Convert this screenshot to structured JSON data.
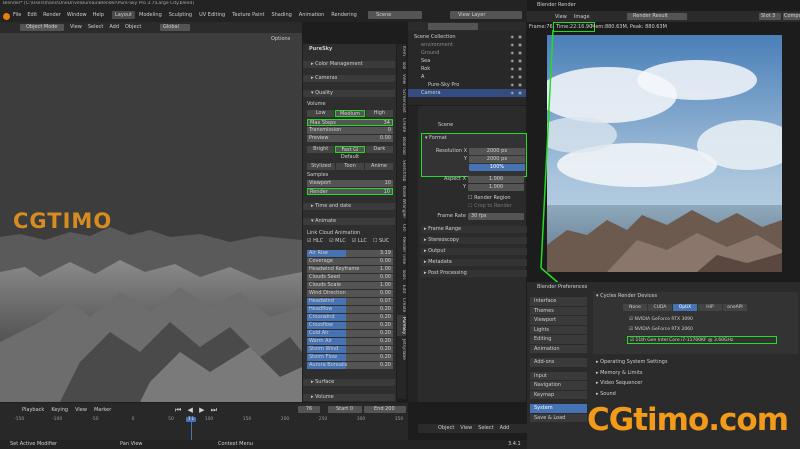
{
  "window": {
    "title": "Blender* [C:\\Users\\hans\\OneDrive\\Bureau\\Blender\\Pure-Sky Pro 3.7\\Large City.blend]"
  },
  "menu": [
    "File",
    "Edit",
    "Render",
    "Window",
    "Help"
  ],
  "workspaces": [
    "Layout",
    "Modeling",
    "Sculpting",
    "UV Editing",
    "Texture Paint",
    "Shading",
    "Animation",
    "Rendering"
  ],
  "viewport": {
    "mode": "Object Mode",
    "header_items": [
      "View",
      "Select",
      "Add",
      "Object"
    ],
    "orientation": "Global",
    "options": "Options"
  },
  "scene_field": "Scene",
  "view_layer": "View Layer",
  "npanel": {
    "title": "PureSky",
    "panels": {
      "color_mgmt": "Color Management",
      "cameras": "Cameras",
      "quality": "Quality"
    },
    "volume": "Volume",
    "quality_buttons": [
      "Low",
      "Medium",
      "High"
    ],
    "max_steps_label": "Max Steps",
    "max_steps": "34",
    "transmission_label": "Transmission",
    "transmission": "0",
    "preview_label": "Preview",
    "preview": "0.00",
    "gi_buttons": [
      "Bright",
      "Fast GI",
      "Dark"
    ],
    "default": "Default",
    "style_buttons": [
      "Stylized",
      "Toon",
      "Anime"
    ],
    "samples": "Samples",
    "viewport_label": "Viewport",
    "viewport_val": "10",
    "render_label": "Render",
    "render_val": "10",
    "time_date": "Time and date",
    "animate": "Animate",
    "link_cloud": "Link Cloud Animation",
    "checks": [
      "HLC",
      "MLC",
      "LLC",
      "SUC"
    ],
    "anim_rows": [
      {
        "label": "Air Rise",
        "val": "3.19",
        "hl": true
      },
      {
        "label": "Coverage",
        "val": "0.00",
        "hl": false
      },
      {
        "label": "Headwind Keyframe",
        "val": "1.00",
        "hl": false
      },
      {
        "label": "Clouds Seed",
        "val": "0.00",
        "hl": false
      },
      {
        "label": "Clouds Scale",
        "val": "1.00",
        "hl": false
      },
      {
        "label": "Wind Direction",
        "val": "0.00",
        "hl": false
      },
      {
        "label": "Headwind",
        "val": "0.07",
        "hl": true
      },
      {
        "label": "Headflow",
        "val": "0.20",
        "hl": true
      },
      {
        "label": "Crosswind",
        "val": "0.20",
        "hl": true
      },
      {
        "label": "Crossflow",
        "val": "0.20",
        "hl": true
      },
      {
        "label": "Cold Air",
        "val": "0.20",
        "hl": true
      },
      {
        "label": "Warm Air",
        "val": "0.20",
        "hl": true
      },
      {
        "label": "Storm Wind",
        "val": "0.20",
        "hl": true
      },
      {
        "label": "Storm Flow",
        "val": "0.20",
        "hl": true
      },
      {
        "label": "Aurora Borealis",
        "val": "0.20",
        "hl": true
      }
    ],
    "surface": "Surface",
    "volume_panel": "Volume"
  },
  "vtabs": [
    "Item",
    "Tool",
    "View",
    "Screencast",
    "Create",
    "BoolTool",
    "Sketchfab",
    "Node Wrangler",
    "CRT",
    "Render Time",
    "Tools",
    "Edit",
    "Create",
    "PureSky",
    "Jetsyllabe"
  ],
  "outliner": {
    "items": [
      {
        "name": "Scene Collection",
        "indent": 0
      },
      {
        "name": "environment",
        "indent": 1
      },
      {
        "name": "Ground",
        "indent": 1
      },
      {
        "name": "Sea",
        "indent": 1
      },
      {
        "name": "Rok",
        "indent": 1
      },
      {
        "name": "A",
        "indent": 1
      },
      {
        "name": "Pure-Sky Pro",
        "indent": 2
      },
      {
        "name": "Camera",
        "indent": 1
      }
    ]
  },
  "props": {
    "scene": "Scene",
    "format": "Format",
    "res_x_label": "Resolution X",
    "res_x": "2000 px",
    "res_y_label": "Y",
    "res_y": "2000 px",
    "res_pct": "100%",
    "aspect_x_label": "Aspect X",
    "aspect_x": "1.000",
    "aspect_y_label": "Y",
    "aspect_y": "1.000",
    "render_region": "Render Region",
    "crop": "Crop to Render",
    "frame_rate_label": "Frame Rate",
    "frame_rate": "30 fps",
    "sections": [
      "Frame Range",
      "Stereoscopy",
      "Output",
      "Metadata",
      "Post Processing"
    ]
  },
  "render_window": {
    "title": "Blender Render",
    "menu": [
      "View",
      "Image"
    ],
    "result": "Render Result",
    "slot": "Slot 3",
    "compositing": "Composite",
    "frame": "Frame:76",
    "time": "Time:22:16.90",
    "mem": "Mem:880.63M, Peak: 880.63M"
  },
  "prefs": {
    "title": "Blender Preferences",
    "nav": [
      "Interface",
      "Themes",
      "Viewport",
      "Lights",
      "Editing",
      "Animation",
      "Add-ons",
      "Input",
      "Navigation",
      "Keymap",
      "System",
      "Save & Load"
    ],
    "cycles": "Cycles Render Devices",
    "device_tabs": [
      "None",
      "CUDA",
      "OptiX",
      "HIP",
      "oneAPI"
    ],
    "devices": [
      "NVIDIA GeForce RTX 3090",
      "NVIDIA GeForce RTX 2060",
      "11th Gen Intel Core i7-11700KF @ 3.60GHz"
    ],
    "sections": [
      "Operating System Settings",
      "Memory & Limits",
      "Video Sequencer",
      "Sound"
    ]
  },
  "timeline": {
    "menu": [
      "Playback",
      "Keying",
      "View",
      "Marker"
    ],
    "frame": "76",
    "start_label": "Start",
    "start": "0",
    "end_label": "End",
    "end": "200",
    "ticks": [
      "-150",
      "-100",
      "-50",
      "0",
      "50",
      "76",
      "100",
      "150",
      "200",
      "250",
      "300",
      "350"
    ]
  },
  "props_footer": {
    "items": [
      "Object",
      "View",
      "Select",
      "Add"
    ]
  },
  "status": {
    "left": "Set Active Modifier",
    "mid": "Pan View",
    "right": "Context Menu",
    "version": "3.4.1"
  },
  "watermark_small": "CGTIMO",
  "watermark_big": "CGtimo.com",
  "colors": {
    "accent": "#4772b3",
    "highlight": "#22dd22",
    "watermark": "#f29a1a"
  }
}
